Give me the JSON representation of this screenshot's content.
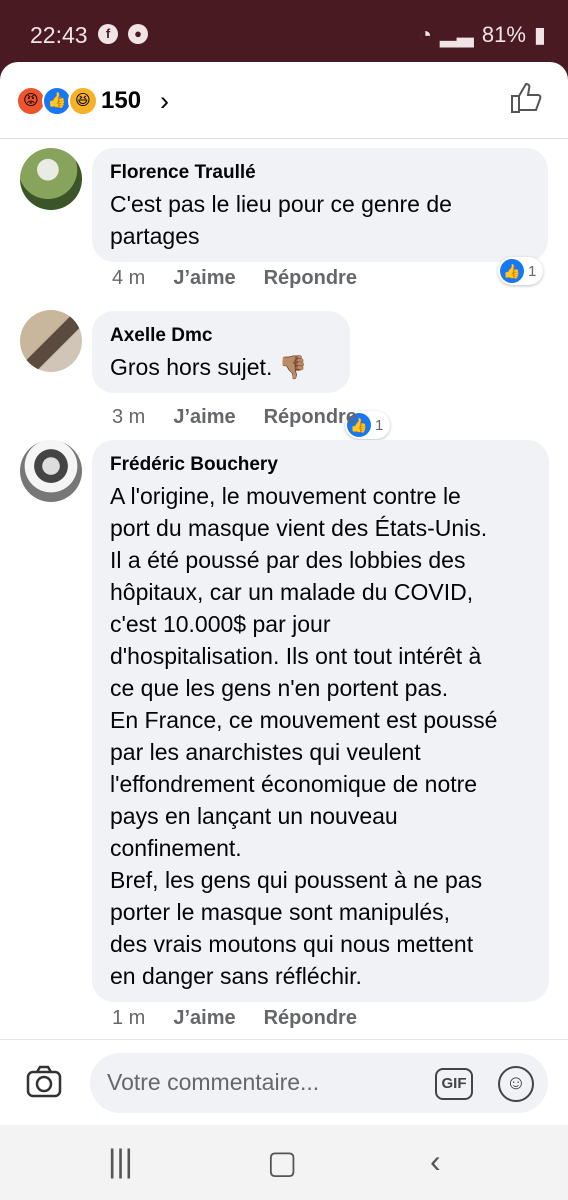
{
  "status": {
    "time": "22:43",
    "battery": "81%"
  },
  "header": {
    "reaction_count": "150"
  },
  "comments": [
    {
      "author": "Florence Traullé",
      "text": "C'est pas le lieu pour ce genre de\npartages",
      "time": "4 m",
      "like": "J’aime",
      "reply": "Répondre",
      "reactions": "1"
    },
    {
      "author": "Axelle Dmc",
      "text": "Gros hors sujet. 👎🏽",
      "time": "3 m",
      "like": "J’aime",
      "reply": "Répondre",
      "reactions": "1"
    },
    {
      "author": "Frédéric Bouchery",
      "text": "A l'origine, le mouvement contre le\nport du masque vient des États-Unis.\nIl a été poussé par des lobbies des\nhôpitaux, car un malade du COVID,\nc'est 10.000$ par jour\nd'hospitalisation. Ils ont tout intérêt à\nce que les gens n'en portent pas.\nEn France, ce mouvement est poussé\npar les anarchistes qui veulent\nl'effondrement économique de notre\npays en lançant un nouveau\nconfinement.\nBref, les gens qui poussent à ne pas\nporter le masque sont manipulés,\ndes vrais moutons qui nous mettent\nen danger sans réfléchir.",
      "time": "1 m",
      "like": "J’aime",
      "reply": "Répondre"
    }
  ],
  "composer": {
    "placeholder": "Votre commentaire...",
    "gif_label": "GIF"
  },
  "colors": {
    "facebook_blue": "#1877f2",
    "status_bar": "#4a1a22"
  }
}
